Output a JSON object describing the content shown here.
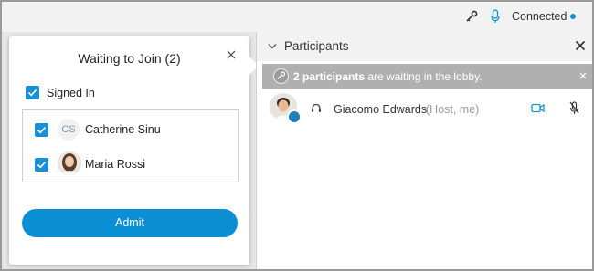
{
  "status_bar": {
    "connection_label": "Connected",
    "connection_color": "#0e93d6"
  },
  "popup": {
    "title": "Waiting to Join (2)",
    "signed_in_label": "Signed In",
    "items": [
      {
        "initials": "CS",
        "name": "Catherine Sinu",
        "checked": true
      },
      {
        "name": "Maria Rossi",
        "checked": true
      }
    ],
    "admit_label": "Admit",
    "accent": "#0b8fd4"
  },
  "panel": {
    "title": "Participants",
    "lobby": {
      "count_text": "2 participants",
      "rest_text": " are waiting in the lobby."
    },
    "participants": [
      {
        "name": "Giacomo Edwards",
        "role": "(Host, me)"
      }
    ]
  }
}
